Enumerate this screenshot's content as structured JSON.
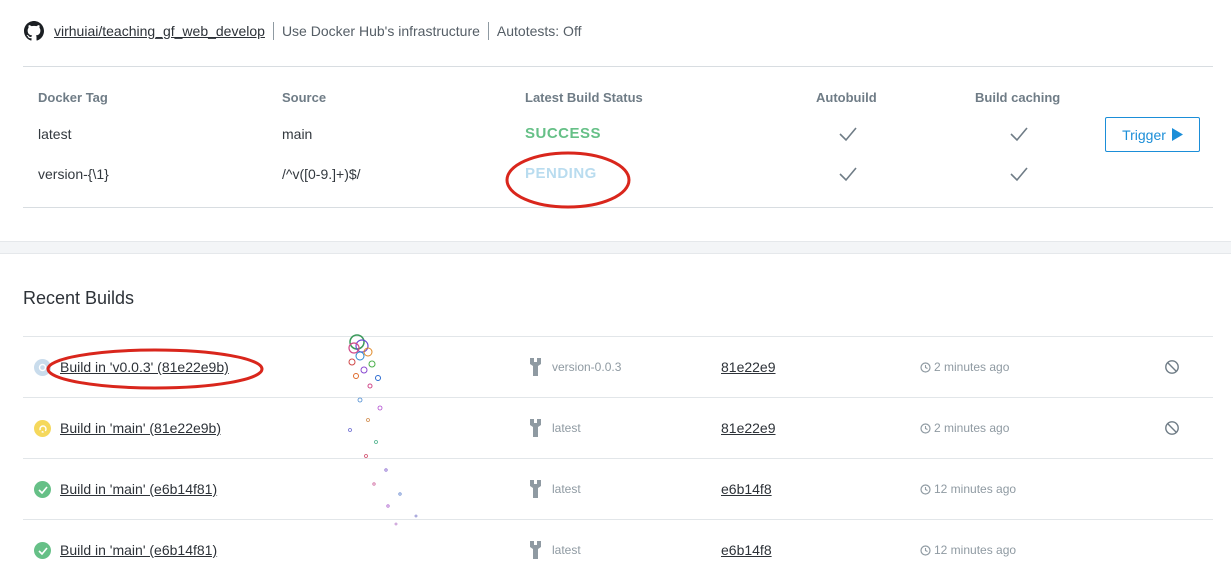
{
  "repo": {
    "name": "virhuiai/teaching_gf_web_develop",
    "infrastructure": "Use Docker Hub's infrastructure",
    "autotests": "Autotests: Off"
  },
  "rules": {
    "headers": {
      "docker_tag": "Docker Tag",
      "source": "Source",
      "status": "Latest Build Status",
      "autobuild": "Autobuild",
      "caching": "Build caching"
    },
    "rows": [
      {
        "tag": "latest",
        "source": "main",
        "status": "SUCCESS",
        "autobuild": true,
        "caching": true
      },
      {
        "tag": "version-{\\1}",
        "source": "/^v([0-9.]+)$/",
        "status": "PENDING",
        "autobuild": true,
        "caching": true
      }
    ],
    "trigger_label": "Trigger"
  },
  "recent_builds": {
    "title": "Recent Builds",
    "items": [
      {
        "label": "Build in 'v0.0.3' (81e22e9b)",
        "status": "queued",
        "tag": "version-0.0.3",
        "commit": "81e22e9",
        "time": "2 minutes ago",
        "cancelable": true
      },
      {
        "label": "Build in 'main' (81e22e9b)",
        "status": "building",
        "tag": "latest",
        "commit": "81e22e9",
        "time": "2 minutes ago",
        "cancelable": true
      },
      {
        "label": "Build in 'main' (e6b14f81)",
        "status": "success",
        "tag": "latest",
        "commit": "e6b14f8",
        "time": "12 minutes ago",
        "cancelable": false
      },
      {
        "label": "Build in 'main' (e6b14f81)",
        "status": "success",
        "tag": "latest",
        "commit": "e6b14f8",
        "time": "12 minutes ago",
        "cancelable": false
      }
    ]
  },
  "colors": {
    "success": "#66c087",
    "pending": "#b9dcef",
    "building": "#f5d85c",
    "queued": "#c9dcec",
    "accent": "#1b8ed8",
    "annotation": "#d9261c"
  },
  "icons": {
    "repo": "github-icon",
    "check": "checkmark-icon",
    "trigger": "play-icon",
    "tag": "wrench-icon",
    "time": "clock-icon",
    "cancel": "cancel-icon"
  }
}
